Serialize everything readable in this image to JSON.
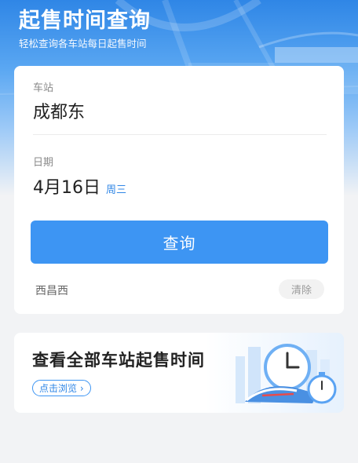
{
  "header": {
    "title": "起售时间查询",
    "subtitle": "轻松查询各车站每日起售时间"
  },
  "form": {
    "station_label": "车站",
    "station_value": "成都东",
    "date_label": "日期",
    "date_value": "4月16日",
    "weekday": "周三",
    "query_button": "查询"
  },
  "history": {
    "items": [
      "西昌西"
    ],
    "clear_button": "清除"
  },
  "banner": {
    "title": "查看全部车站起售时间",
    "button": "点击浏览 ›"
  },
  "colors": {
    "accent": "#3d95f3",
    "header_blue": "#2f86e6",
    "background": "#f2f3f5"
  },
  "icons": [
    "clock-icon",
    "stopwatch-icon",
    "train-icon"
  ]
}
